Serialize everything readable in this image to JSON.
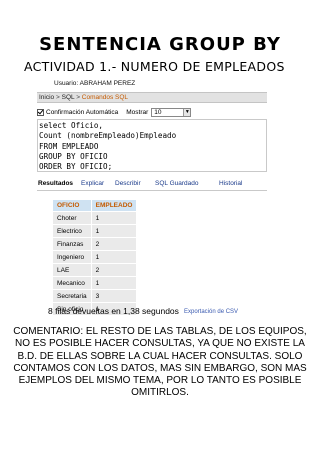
{
  "document": {
    "title": "SENTENCIA GROUP BY",
    "subtitle": "ACTIVIDAD 1.- NUMERO DE EMPLEADOS",
    "comment": "COMENTARIO: EL RESTO DE LAS TABLAS, DE LOS EQUIPOS, NO ES POSIBLE HACER CONSULTAS, YA QUE NO EXISTE LA B.D. DE ELLAS SOBRE LA CUAL HACER CONSULTAS. SOLO CONTAMOS CON LOS DATOS, MAS SIN EMBARGO, SON MAS EJEMPLOS DEL MISMO TEMA, POR LO TANTO ES POSIBLE OMITIRLOS."
  },
  "app": {
    "user_line": "Usuario: ABRAHAM PEREZ",
    "breadcrumb": [
      "Inicio",
      "SQL",
      "Comandos SQL"
    ],
    "breadcrumb_sep": ">",
    "autocommit_label": "Confirmación Automática",
    "autocommit_checked": true,
    "show_label": "Mostrar",
    "show_value": "10",
    "sql_text": "select Oficio,\nCount (nombreEmpleado)Empleado\nFROM EMPLEADO\nGROUP BY OFICIO\nORDER BY OFICIO;",
    "tabs": [
      "Resultados",
      "Explicar",
      "Describir",
      "SQL Guardado",
      "Historial"
    ],
    "active_tab": "Resultados",
    "table": {
      "headers": [
        "OFICIO",
        "EMPLEADO"
      ],
      "rows": [
        [
          "Choter",
          "1"
        ],
        [
          "Electrico",
          "1"
        ],
        [
          "Finanzas",
          "2"
        ],
        [
          "Ingeniero",
          "1"
        ],
        [
          "LAE",
          "2"
        ],
        [
          "Mecanico",
          "1"
        ],
        [
          "Secretaria",
          "3"
        ],
        [
          "Sin oficio",
          "1"
        ]
      ]
    },
    "rows_info": "8 filas devueltas en 1,38 segundos",
    "csv_link": "Exportación de CSV"
  },
  "colors": {
    "accent_orange": "#c45a00",
    "header_blue": "#cfe2f2",
    "link_blue": "#1a3a8a"
  }
}
